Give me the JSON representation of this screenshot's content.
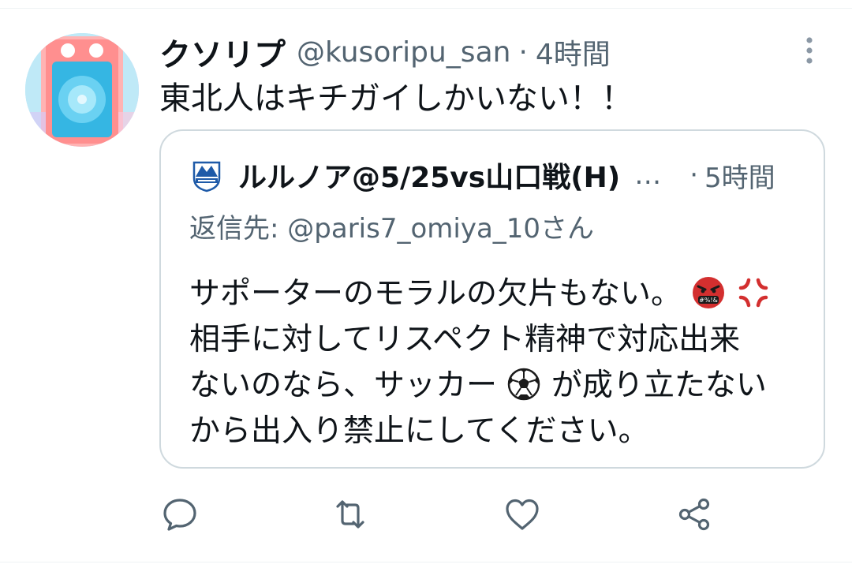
{
  "tweet": {
    "author_name": "クソリプ",
    "handle": "@kusoripu_san",
    "separator": "·",
    "time": "4時間",
    "text": "東北人はキチガイしかいない！！"
  },
  "quoted": {
    "author_name": "ルルノア@5/25vs山口戦(H)",
    "ellipsis": "…",
    "separator": "·",
    "time": "5時間",
    "reply_prefix": "返信先:",
    "reply_to": "@paris7_omiya_10さん",
    "lines": [
      "サポーターのモラルの欠片もない。",
      "相手に対してリスペクト精神で対応出来",
      "ないのなら、サッカー",
      "が成り立たない",
      "から出入り禁止にしてください。"
    ]
  },
  "icons": {
    "more": "more-vertical-icon",
    "reply": "reply-icon",
    "retweet": "retweet-icon",
    "like": "heart-icon",
    "share": "share-icon",
    "emoji1": "cursing-face-emoji",
    "emoji2": "anger-symbol-emoji",
    "emoji3": "soccer-ball-emoji"
  },
  "colors": {
    "text": "#0f1419",
    "secondary": "#536471",
    "border": "#cfd9de",
    "icon": "#536471"
  }
}
